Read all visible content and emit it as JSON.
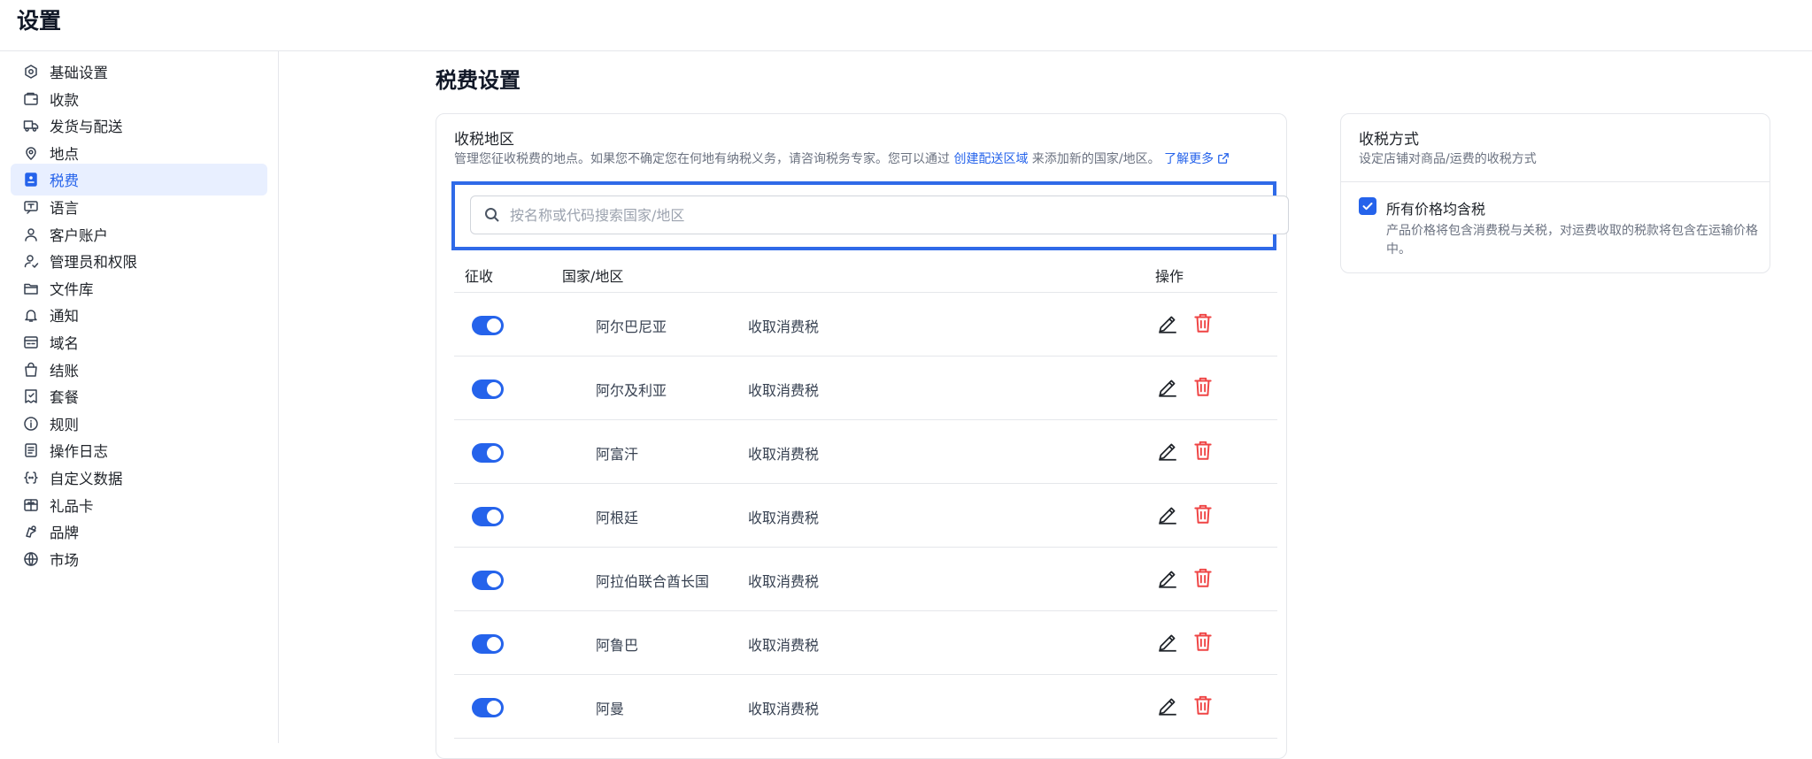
{
  "header": {
    "title": "设置"
  },
  "sidebar": {
    "items": [
      {
        "label": "基础设置",
        "icon": "settings-hex-icon"
      },
      {
        "label": "收款",
        "icon": "wallet-icon"
      },
      {
        "label": "发货与配送",
        "icon": "truck-icon"
      },
      {
        "label": "地点",
        "icon": "location-pin-icon"
      },
      {
        "label": "税费",
        "icon": "tax-icon",
        "active": true
      },
      {
        "label": "语言",
        "icon": "language-icon"
      },
      {
        "label": "客户账户",
        "icon": "user-icon"
      },
      {
        "label": "管理员和权限",
        "icon": "admin-user-icon"
      },
      {
        "label": "文件库",
        "icon": "folder-icon"
      },
      {
        "label": "通知",
        "icon": "bell-icon"
      },
      {
        "label": "域名",
        "icon": "domain-icon"
      },
      {
        "label": "结账",
        "icon": "shopping-bag-icon"
      },
      {
        "label": "套餐",
        "icon": "plan-icon"
      },
      {
        "label": "规则",
        "icon": "info-icon"
      },
      {
        "label": "操作日志",
        "icon": "log-icon"
      },
      {
        "label": "自定义数据",
        "icon": "code-braces-icon"
      },
      {
        "label": "礼品卡",
        "icon": "gift-card-icon"
      },
      {
        "label": "品牌",
        "icon": "brand-icon"
      },
      {
        "label": "市场",
        "icon": "globe-icon"
      }
    ]
  },
  "main": {
    "page_title": "税费设置",
    "regions": {
      "title": "收税地区",
      "desc_before": "管理您征收税费的地点。如果您不确定您在何地有纳税义务，请咨询税务专家。您可以通过 ",
      "desc_link": "创建配送区域",
      "desc_after": " 来添加新的国家/地区。",
      "learn_more": "了解更多",
      "search_placeholder": "按名称或代码搜索国家/地区",
      "columns": {
        "collect": "征收",
        "country": "国家/地区",
        "actions": "操作"
      },
      "rows": [
        {
          "country": "阿尔巴尼亚",
          "tax": "收取消费税",
          "enabled": true
        },
        {
          "country": "阿尔及利亚",
          "tax": "收取消费税",
          "enabled": true
        },
        {
          "country": "阿富汗",
          "tax": "收取消费税",
          "enabled": true
        },
        {
          "country": "阿根廷",
          "tax": "收取消费税",
          "enabled": true
        },
        {
          "country": "阿拉伯联合酋长国",
          "tax": "收取消费税",
          "enabled": true
        },
        {
          "country": "阿鲁巴",
          "tax": "收取消费税",
          "enabled": true
        },
        {
          "country": "阿曼",
          "tax": "收取消费税",
          "enabled": true
        }
      ]
    },
    "method": {
      "title": "收税方式",
      "desc": "设定店铺对商品/运费的收税方式",
      "option_label": "所有价格均含税",
      "option_checked": true,
      "option_desc": "产品价格将包含消费税与关税，对运费收取的税款将包含在运输价格中。"
    }
  },
  "colors": {
    "accent": "#2563eb",
    "focus_ring": "#2f6ae8",
    "delete": "#ef4444",
    "active_bg": "#e8efff"
  }
}
